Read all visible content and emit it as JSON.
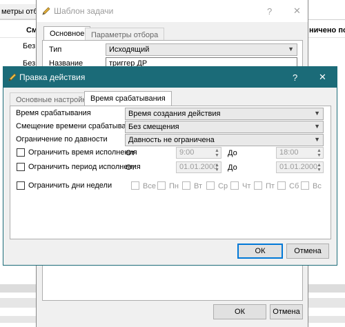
{
  "background": {
    "tab_label": "метры отбора",
    "col_header_1": "См",
    "col_header_2": "ничено по д",
    "rows": [
      "Без с",
      "Без с",
      "Без с"
    ]
  },
  "template_dialog": {
    "title": "Шаблон задачи",
    "help_label": "?",
    "close_label": "✕",
    "tabs": [
      {
        "label": "Основное",
        "active": true
      },
      {
        "label": "Параметры отбора",
        "active": false
      }
    ],
    "type_label": "Тип",
    "type_value": "Исходящий",
    "name_label": "Название",
    "name_value": "триггер ДР",
    "ok_label": "ОК",
    "cancel_label": "Отмена"
  },
  "action_dialog": {
    "title": "Правка действия",
    "help_label": "?",
    "close_label": "✕",
    "tabs": [
      {
        "label": "Основные настройки",
        "active": false
      },
      {
        "label": "Время срабатывания",
        "active": true
      }
    ],
    "fields": {
      "trigger_time_label": "Время срабатывания",
      "trigger_time_value": "Время создания действия",
      "offset_label": "Смещение времени срабатывания",
      "offset_value": "Без смещения",
      "age_limit_label": "Ограничение по давности",
      "age_limit_value": "Давность не ограничена"
    },
    "limit_time": {
      "label": "Ограничить время исполнения",
      "checked": false,
      "from_label": "От",
      "from_value": "9:00",
      "to_label": "До",
      "to_value": "18:00"
    },
    "limit_period": {
      "label": "Ограничить период исполнения",
      "checked": false,
      "from_label": "От",
      "from_value": "01.01.2000",
      "to_label": "До",
      "to_value": "01.01.2000"
    },
    "limit_days": {
      "label": "Ограничить дни недели",
      "checked": false,
      "days": [
        "Все",
        "Пн",
        "Вт",
        "Ср",
        "Чт",
        "Пт",
        "Сб",
        "Вс"
      ]
    },
    "ok_label": "ОК",
    "cancel_label": "Отмена"
  },
  "colors": {
    "action_titlebar": "#1b6b78",
    "focus_border": "#0078d7"
  }
}
